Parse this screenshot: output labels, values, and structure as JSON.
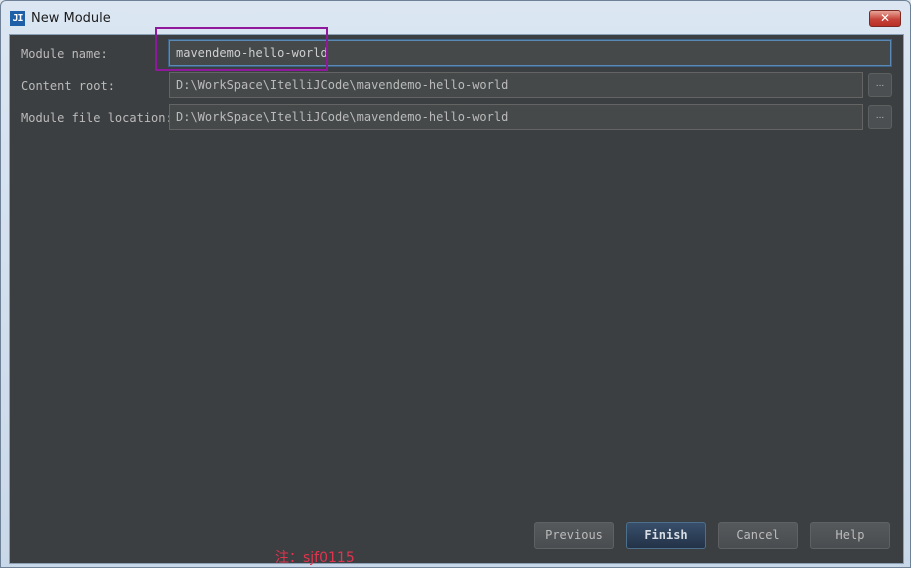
{
  "window": {
    "app_icon": "JI",
    "title": "New Module",
    "close_glyph": "✕"
  },
  "form": {
    "module_name": {
      "label": "Module name:",
      "value": "mavendemo-hello-world"
    },
    "content_root": {
      "label": "Content root:",
      "value": "D:\\WorkSpace\\ItelliJCode\\mavendemo-hello-world",
      "browse_label": "..."
    },
    "module_file_location": {
      "label": "Module file location:",
      "value": "D:\\WorkSpace\\ItelliJCode\\mavendemo-hello-world",
      "browse_label": "..."
    }
  },
  "buttons": {
    "previous": "Previous",
    "finish": "Finish",
    "cancel": "Cancel",
    "help": "Help"
  },
  "watermark": "注：sjf0115",
  "colors": {
    "highlight_box": "#8f189c",
    "dialog_background": "#3c3f41",
    "watermark": "#e2334f"
  }
}
